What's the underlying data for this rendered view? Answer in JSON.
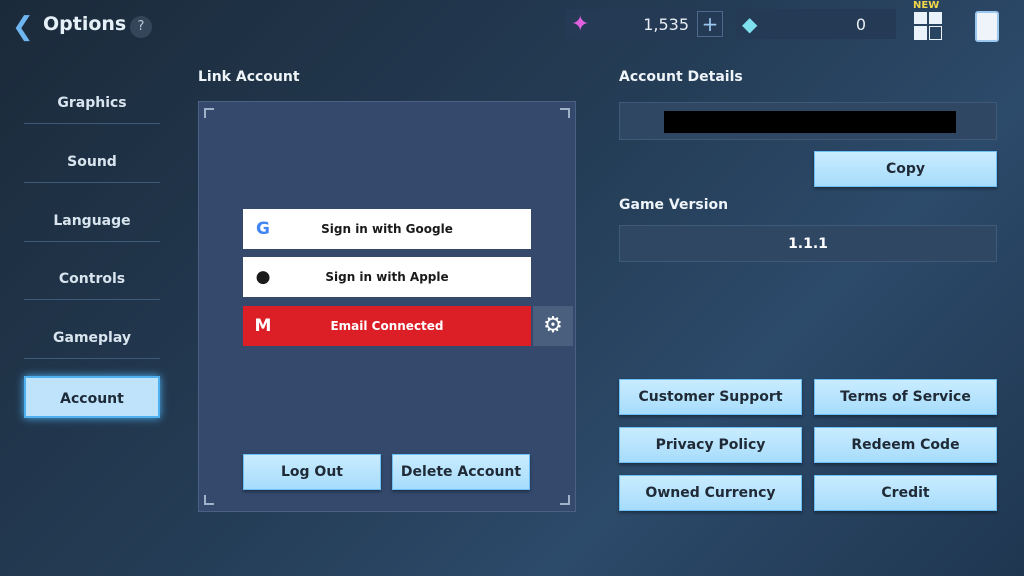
{
  "header": {
    "title": "Options",
    "help": "?",
    "crystals": "1,535",
    "plus": "+",
    "gems": "0",
    "new_badge": "NEW"
  },
  "sidebar": {
    "items": [
      {
        "label": "Graphics"
      },
      {
        "label": "Sound"
      },
      {
        "label": "Language"
      },
      {
        "label": "Controls"
      },
      {
        "label": "Gameplay"
      },
      {
        "label": "Account",
        "active": true
      }
    ]
  },
  "link": {
    "heading": "Link Account",
    "google": "Sign in with Google",
    "apple": "Sign in with Apple",
    "email": "Email Connected",
    "logout": "Log Out",
    "delete": "Delete Account"
  },
  "details": {
    "heading": "Account Details",
    "copy": "Copy",
    "version_heading": "Game Version",
    "version": "1.1.1"
  },
  "buttons": [
    "Customer Support",
    "Terms of Service",
    "Privacy Policy",
    "Redeem Code",
    "Owned Currency",
    "Credit"
  ],
  "colors": {
    "email": "#dc1f26",
    "accent": "#a6dcfb"
  }
}
